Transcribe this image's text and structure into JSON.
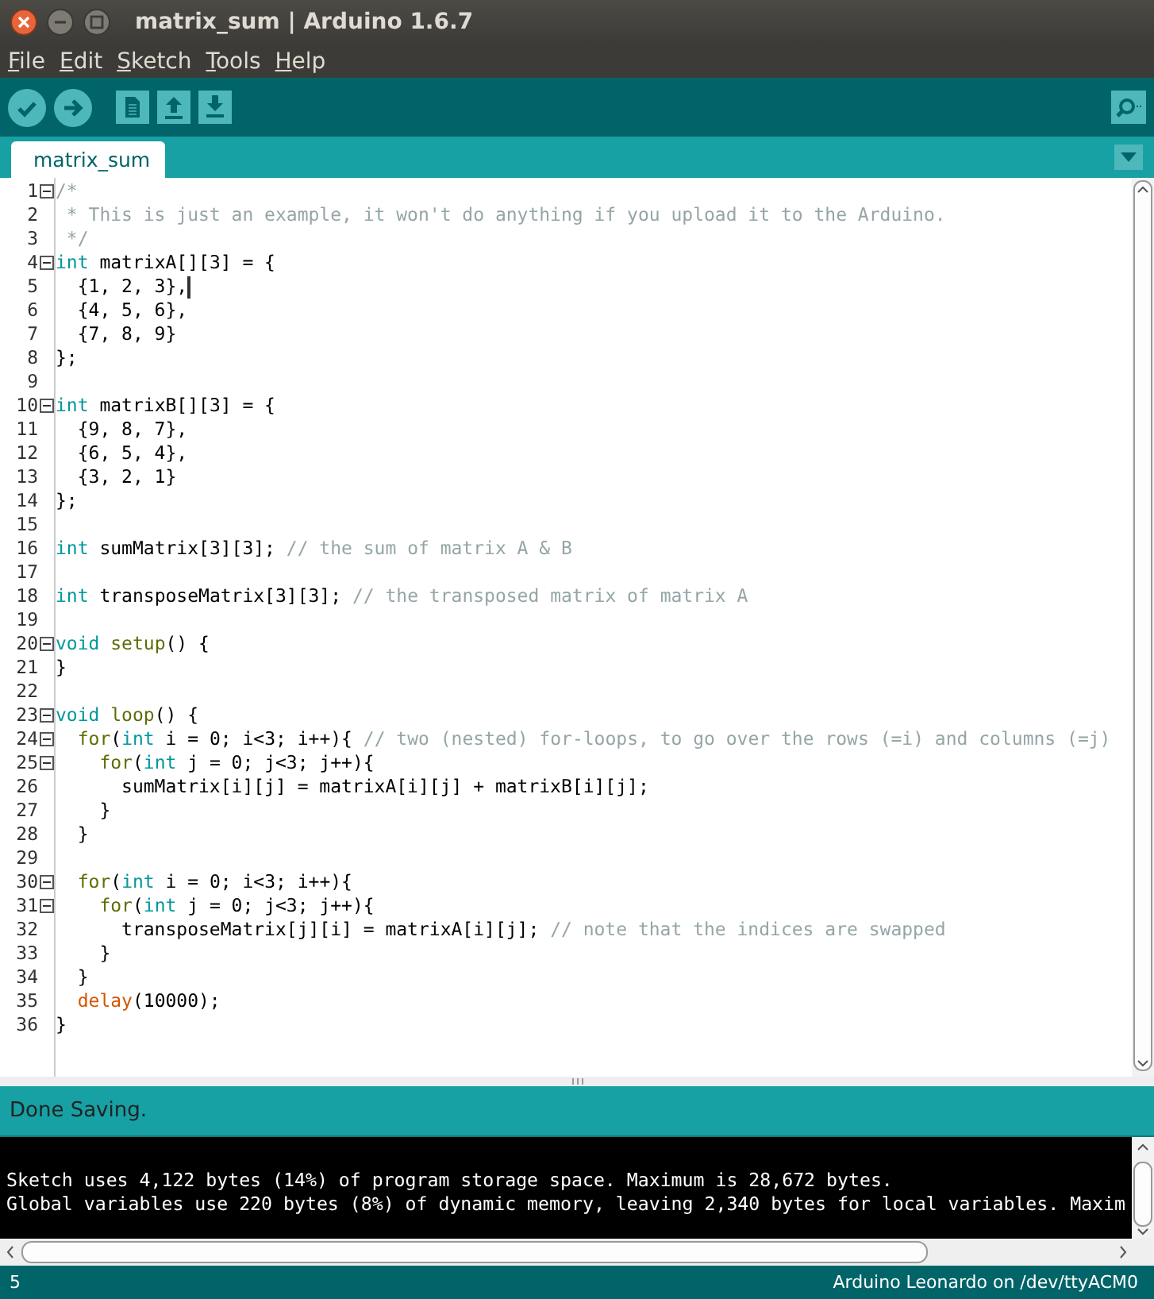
{
  "window": {
    "title": "matrix_sum | Arduino 1.6.7"
  },
  "menu": [
    "File",
    "Edit",
    "Sketch",
    "Tools",
    "Help"
  ],
  "tabs": [
    {
      "label": "matrix_sum",
      "selected": true
    }
  ],
  "editor": {
    "lines": [
      {
        "n": "1",
        "fold": true,
        "tokens": [
          {
            "kind": "comment",
            "text": "/*"
          }
        ]
      },
      {
        "n": "2",
        "fold": false,
        "tokens": [
          {
            "kind": "comment",
            "text": " * This is just an example, it won't do anything if you upload it to the Arduino."
          }
        ]
      },
      {
        "n": "3",
        "fold": false,
        "tokens": [
          {
            "kind": "comment",
            "text": " */"
          }
        ]
      },
      {
        "n": "4",
        "fold": true,
        "tokens": [
          {
            "kind": "type",
            "text": "int"
          },
          {
            "kind": "plain",
            "text": " matrixA[][3] = {"
          }
        ]
      },
      {
        "n": "5",
        "fold": false,
        "caret": true,
        "tokens": [
          {
            "kind": "plain",
            "text": "  {1, 2, 3},"
          }
        ]
      },
      {
        "n": "6",
        "fold": false,
        "tokens": [
          {
            "kind": "plain",
            "text": "  {4, 5, 6},"
          }
        ]
      },
      {
        "n": "7",
        "fold": false,
        "tokens": [
          {
            "kind": "plain",
            "text": "  {7, 8, 9}"
          }
        ]
      },
      {
        "n": "8",
        "fold": false,
        "tokens": [
          {
            "kind": "plain",
            "text": "};"
          }
        ]
      },
      {
        "n": "9",
        "fold": false
      },
      {
        "n": "10",
        "fold": true,
        "tokens": [
          {
            "kind": "type",
            "text": "int"
          },
          {
            "kind": "plain",
            "text": " matrixB[][3] = {"
          }
        ]
      },
      {
        "n": "11",
        "fold": false,
        "tokens": [
          {
            "kind": "plain",
            "text": "  {9, 8, 7},"
          }
        ]
      },
      {
        "n": "12",
        "fold": false,
        "tokens": [
          {
            "kind": "plain",
            "text": "  {6, 5, 4},"
          }
        ]
      },
      {
        "n": "13",
        "fold": false,
        "tokens": [
          {
            "kind": "plain",
            "text": "  {3, 2, 1}"
          }
        ]
      },
      {
        "n": "14",
        "fold": false,
        "tokens": [
          {
            "kind": "plain",
            "text": "};"
          }
        ]
      },
      {
        "n": "15",
        "fold": false
      },
      {
        "n": "16",
        "fold": false,
        "tokens": [
          {
            "kind": "type",
            "text": "int"
          },
          {
            "kind": "plain",
            "text": " sumMatrix[3][3]; "
          },
          {
            "kind": "comment",
            "text": "// the sum of matrix A & B"
          }
        ]
      },
      {
        "n": "17",
        "fold": false
      },
      {
        "n": "18",
        "fold": false,
        "tokens": [
          {
            "kind": "type",
            "text": "int"
          },
          {
            "kind": "plain",
            "text": " transposeMatrix[3][3]; "
          },
          {
            "kind": "comment",
            "text": "// the transposed matrix of matrix A"
          }
        ]
      },
      {
        "n": "19",
        "fold": false
      },
      {
        "n": "20",
        "fold": true,
        "tokens": [
          {
            "kind": "type",
            "text": "void"
          },
          {
            "kind": "function",
            "text": " setup"
          },
          {
            "kind": "plain",
            "text": "() {"
          }
        ]
      },
      {
        "n": "21",
        "fold": false,
        "tokens": [
          {
            "kind": "plain",
            "text": "}"
          }
        ]
      },
      {
        "n": "22",
        "fold": false
      },
      {
        "n": "23",
        "fold": true,
        "tokens": [
          {
            "kind": "type",
            "text": "void"
          },
          {
            "kind": "function",
            "text": " loop"
          },
          {
            "kind": "plain",
            "text": "() {"
          }
        ]
      },
      {
        "n": "24",
        "fold": true,
        "tokens": [
          {
            "kind": "keyword",
            "text": "  for"
          },
          {
            "kind": "plain",
            "text": "("
          },
          {
            "kind": "type",
            "text": "int"
          },
          {
            "kind": "plain",
            "text": " i = 0; i<3; i++){ "
          },
          {
            "kind": "comment",
            "text": "// two (nested) for-loops, to go over the rows (=i) and columns (=j)"
          }
        ]
      },
      {
        "n": "25",
        "fold": true,
        "tokens": [
          {
            "kind": "keyword",
            "text": "    for"
          },
          {
            "kind": "plain",
            "text": "("
          },
          {
            "kind": "type",
            "text": "int"
          },
          {
            "kind": "plain",
            "text": " j = 0; j<3; j++){"
          }
        ]
      },
      {
        "n": "26",
        "fold": false,
        "tokens": [
          {
            "kind": "plain",
            "text": "      sumMatrix[i][j] = matrixA[i][j] + matrixB[i][j];"
          }
        ]
      },
      {
        "n": "27",
        "fold": false,
        "tokens": [
          {
            "kind": "plain",
            "text": "    }"
          }
        ]
      },
      {
        "n": "28",
        "fold": false,
        "tokens": [
          {
            "kind": "plain",
            "text": "  }"
          }
        ]
      },
      {
        "n": "29",
        "fold": false
      },
      {
        "n": "30",
        "fold": true,
        "tokens": [
          {
            "kind": "keyword",
            "text": "  for"
          },
          {
            "kind": "plain",
            "text": "("
          },
          {
            "kind": "type",
            "text": "int"
          },
          {
            "kind": "plain",
            "text": " i = 0; i<3; i++){"
          }
        ]
      },
      {
        "n": "31",
        "fold": true,
        "tokens": [
          {
            "kind": "keyword",
            "text": "    for"
          },
          {
            "kind": "plain",
            "text": "("
          },
          {
            "kind": "type",
            "text": "int"
          },
          {
            "kind": "plain",
            "text": " j = 0; j<3; j++){"
          }
        ]
      },
      {
        "n": "32",
        "fold": false,
        "tokens": [
          {
            "kind": "plain",
            "text": "      transposeMatrix[j][i] = matrixA[i][j]; "
          },
          {
            "kind": "comment",
            "text": "// note that the indices are swapped"
          }
        ]
      },
      {
        "n": "33",
        "fold": false,
        "tokens": [
          {
            "kind": "plain",
            "text": "    }"
          }
        ]
      },
      {
        "n": "34",
        "fold": false,
        "tokens": [
          {
            "kind": "plain",
            "text": "  }"
          }
        ]
      },
      {
        "n": "35",
        "fold": false,
        "tokens": [
          {
            "kind": "builtin",
            "text": "  delay"
          },
          {
            "kind": "plain",
            "text": "(10000);"
          }
        ]
      },
      {
        "n": "36",
        "fold": false,
        "tokens": [
          {
            "kind": "plain",
            "text": "}"
          }
        ]
      }
    ]
  },
  "status": "Done Saving.",
  "console": [
    "Sketch uses 4,122 bytes (14%) of program storage space. Maximum is 28,672 bytes.",
    "Global variables use 220 bytes (8%) of dynamic memory, leaving 2,340 bytes for local variables. Maxim"
  ],
  "footer": {
    "line": "5",
    "board": "Arduino Leonardo on /dev/ttyACM0"
  }
}
